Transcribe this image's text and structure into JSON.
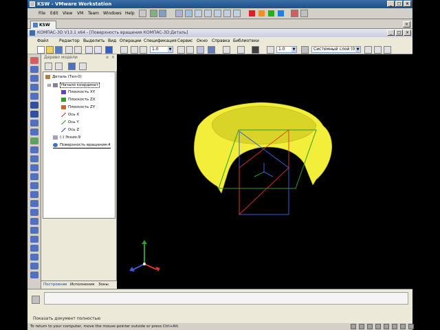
{
  "vm": {
    "title": "KSW - VMware Workstation",
    "menus": [
      "File",
      "Edit",
      "View",
      "VM",
      "Team",
      "Windows",
      "Help"
    ],
    "tab": "KSW",
    "status_hint": "To return to your computer, move the mouse pointer outside or press Ctrl+Alt."
  },
  "app": {
    "title": "КОМПАС-3D V13.1 x64 - [Поверхность вращения КОМПАС-3D:Деталь]",
    "menus": [
      "Файл",
      "Редактор",
      "Выделить",
      "Вид",
      "Операции",
      "Спецификация",
      "Сервис",
      "Окно",
      "Справка",
      "Библиотеки"
    ],
    "toolbar": {
      "scale_value": "1.0",
      "step_value": "1.0",
      "layer_value": "Системный слой (0)"
    },
    "status": "Показать документ полностью"
  },
  "tree": {
    "header": "Дерево модели",
    "items": [
      {
        "label": "Деталь (Тел-0)"
      },
      {
        "label": "Начало координат"
      },
      {
        "label": "Плоскость XY"
      },
      {
        "label": "Плоскость ZX"
      },
      {
        "label": "Плоскость ZY"
      },
      {
        "label": "Ось X"
      },
      {
        "label": "Ось Y"
      },
      {
        "label": "Ось Z"
      },
      {
        "label": "(-) Эскиз:9"
      },
      {
        "label": "Поверхность вращения:4"
      }
    ],
    "tabs": [
      "Построение",
      "Исполнения",
      "Зоны"
    ]
  },
  "colors": {
    "surface": "#f2ee3a",
    "surface_inner": "#d8d428",
    "plane_xy": "#3d5bd8",
    "plane_zx": "#2a9d2a",
    "plane_zy": "#d83a2a"
  }
}
